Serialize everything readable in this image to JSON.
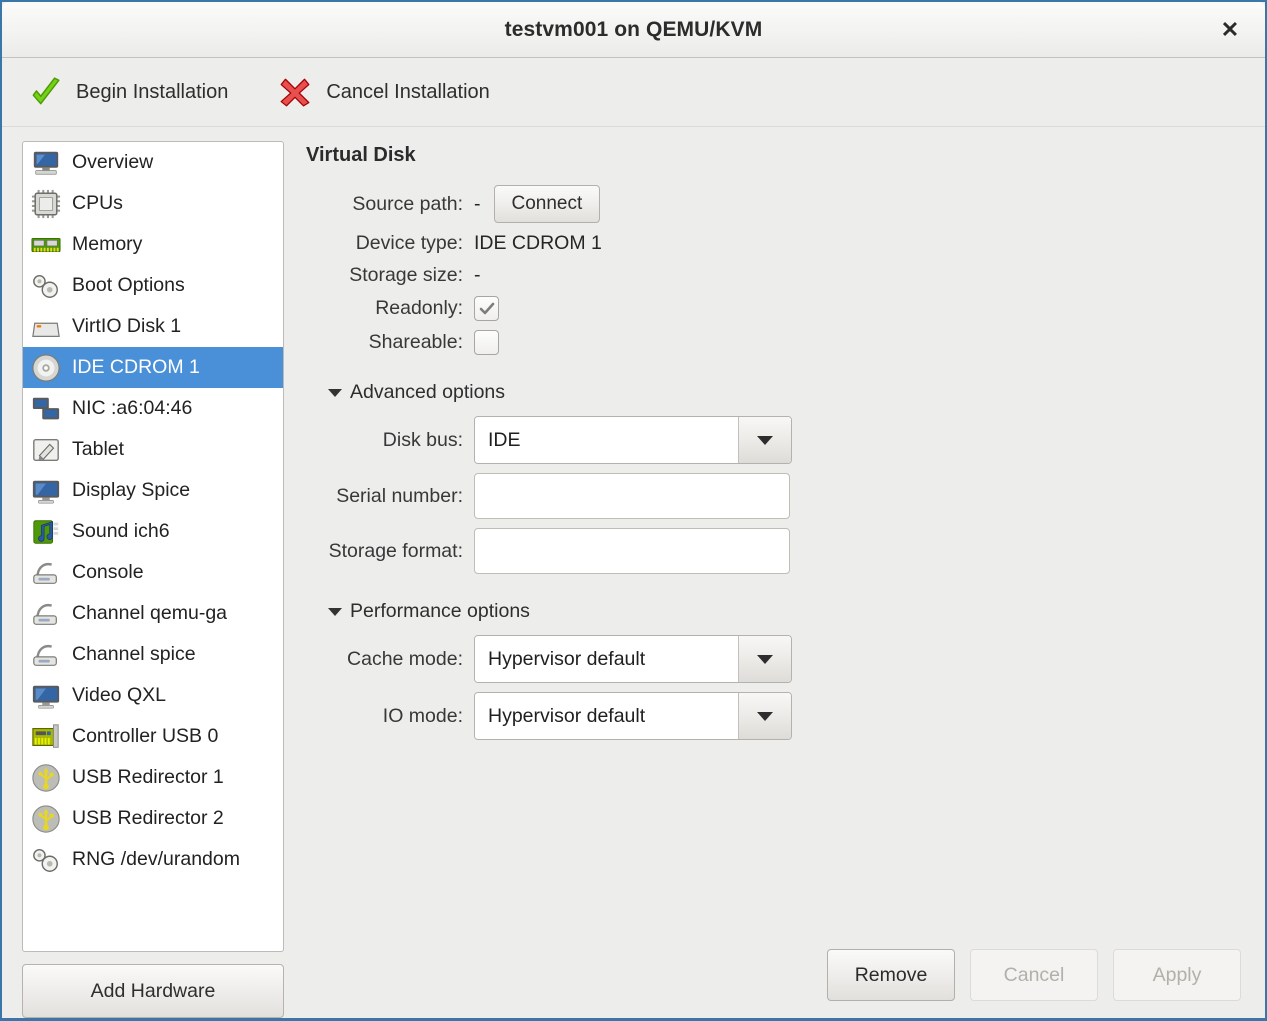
{
  "window": {
    "title": "testvm001 on QEMU/KVM",
    "close_label": "✕",
    "accent_color": "#4a90d9",
    "frame_color": "#3a76a8"
  },
  "toolbar": {
    "items": [
      {
        "label": "Begin Installation",
        "icon": "green-check-icon"
      },
      {
        "label": "Cancel Installation",
        "icon": "red-x-icon"
      }
    ]
  },
  "sidebar": {
    "add_hardware_label": "Add Hardware",
    "items": [
      {
        "label": "Overview",
        "icon": "computer-icon",
        "selected": false
      },
      {
        "label": "CPUs",
        "icon": "cpu-chip-icon",
        "selected": false
      },
      {
        "label": "Memory",
        "icon": "memory-module-icon",
        "selected": false
      },
      {
        "label": "Boot Options",
        "icon": "gears-icon",
        "selected": false
      },
      {
        "label": "VirtIO Disk 1",
        "icon": "harddisk-icon",
        "selected": false
      },
      {
        "label": "IDE CDROM 1",
        "icon": "cdrom-icon",
        "selected": true
      },
      {
        "label": "NIC :a6:04:46",
        "icon": "network-icon",
        "selected": false
      },
      {
        "label": "Tablet",
        "icon": "tablet-pen-icon",
        "selected": false
      },
      {
        "label": "Display Spice",
        "icon": "display-icon",
        "selected": false
      },
      {
        "label": "Sound ich6",
        "icon": "sound-icon",
        "selected": false
      },
      {
        "label": "Console",
        "icon": "serial-console-icon",
        "selected": false
      },
      {
        "label": "Channel qemu-ga",
        "icon": "serial-console-icon",
        "selected": false
      },
      {
        "label": "Channel spice",
        "icon": "serial-console-icon",
        "selected": false
      },
      {
        "label": "Video QXL",
        "icon": "display-icon",
        "selected": false
      },
      {
        "label": "Controller USB 0",
        "icon": "controller-card-icon",
        "selected": false
      },
      {
        "label": "USB Redirector 1",
        "icon": "usb-icon",
        "selected": false
      },
      {
        "label": "USB Redirector 2",
        "icon": "usb-icon",
        "selected": false
      },
      {
        "label": "RNG /dev/urandom",
        "icon": "gears-icon",
        "selected": false
      }
    ]
  },
  "panel": {
    "title": "Virtual Disk",
    "source_path": {
      "label": "Source path:",
      "value": "-",
      "button": "Connect"
    },
    "device_type": {
      "label": "Device type:",
      "value": "IDE CDROM 1"
    },
    "storage_size": {
      "label": "Storage size:",
      "value": "-"
    },
    "readonly": {
      "label": "Readonly:",
      "checked": true
    },
    "shareable": {
      "label": "Shareable:",
      "checked": false
    },
    "advanced": {
      "title": "Advanced options",
      "expanded": true,
      "disk_bus": {
        "label": "Disk bus:",
        "value": "IDE"
      },
      "serial_number": {
        "label": "Serial number:",
        "value": "",
        "placeholder": ""
      },
      "storage_format": {
        "label": "Storage format:",
        "value": "",
        "placeholder": ""
      }
    },
    "performance": {
      "title": "Performance options",
      "expanded": true,
      "cache_mode": {
        "label": "Cache mode:",
        "value": "Hypervisor default"
      },
      "io_mode": {
        "label": "IO mode:",
        "value": "Hypervisor default"
      }
    }
  },
  "footer": {
    "remove_label": "Remove",
    "cancel_label": "Cancel",
    "apply_label": "Apply"
  }
}
